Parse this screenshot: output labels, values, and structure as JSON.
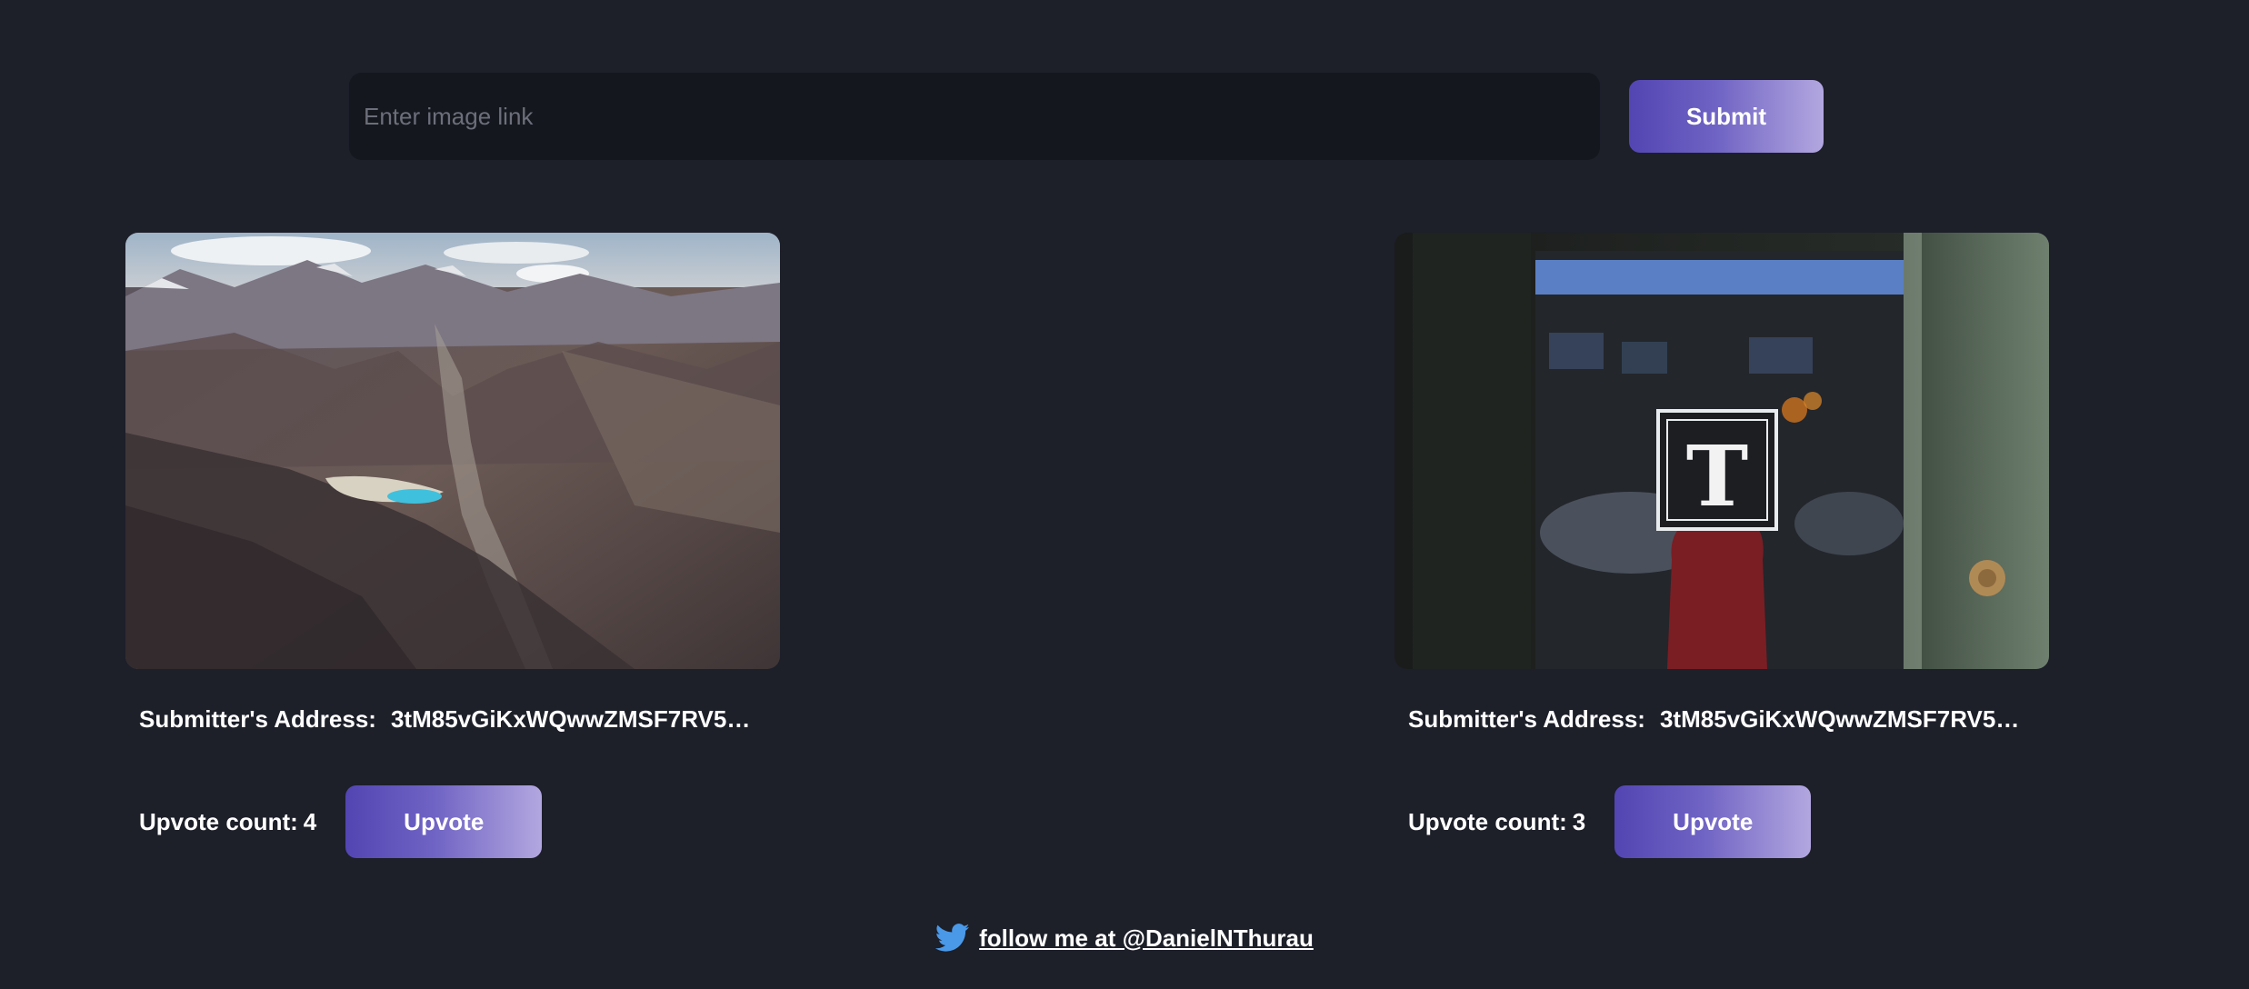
{
  "submit_form": {
    "input_placeholder": "Enter image link",
    "input_value": "",
    "submit_label": "Submit"
  },
  "posts": [
    {
      "image_subject": "aerial view of mountain range with turquoise lake",
      "address_label": "Submitter's Address:",
      "address_value": "3tM85vGiKxWQwwZMSF7RV5b…",
      "upvote_label": "Upvote count:",
      "upvote_count": "4",
      "upvote_button": "Upvote"
    },
    {
      "image_subject": "shop door window with ornate T logo and person in red shirt",
      "address_label": "Submitter's Address:",
      "address_value": "3tM85vGiKxWQwwZMSF7RV5b…",
      "upvote_label": "Upvote count:",
      "upvote_count": "3",
      "upvote_button": "Upvote"
    }
  ],
  "footer": {
    "icon": "twitter-bird-icon",
    "link_text": "follow me at @DanielNThurau"
  },
  "colors": {
    "background": "#1d1f29",
    "input_bg": "#15171e",
    "button_gradient_start": "#5345b2",
    "button_gradient_end": "#b3a7e0",
    "twitter_blue": "#4a99e9"
  }
}
